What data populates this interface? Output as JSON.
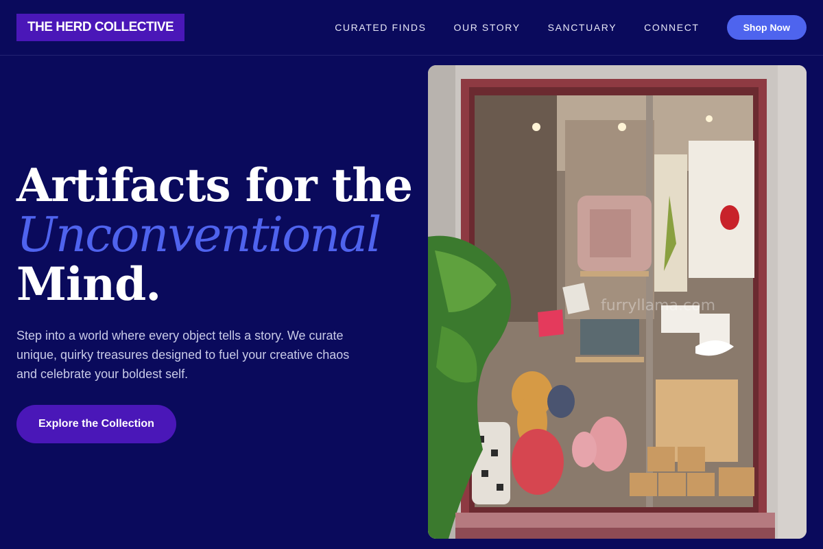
{
  "brand": {
    "name": "THE HERD COLLECTIVE"
  },
  "nav": {
    "items": [
      "CURATED FINDS",
      "OUR STORY",
      "SANCTUARY",
      "CONNECT"
    ],
    "cta": "Shop Now"
  },
  "hero": {
    "title_line1": "Artifacts for the",
    "title_accent": "Unconventional",
    "title_line3": "Mind.",
    "description": "Step into a world where every object tells a story. We curate unique, quirky treasures designed to fuel your creative chaos and celebrate your boldest self.",
    "cta": "Explore the Collection"
  },
  "image": {
    "watermark": "furryllama.com"
  },
  "colors": {
    "background": "#0a0a5c",
    "logo_bg": "#4a17b8",
    "accent": "#4e64ee",
    "cta_bg": "#4a17b8"
  }
}
